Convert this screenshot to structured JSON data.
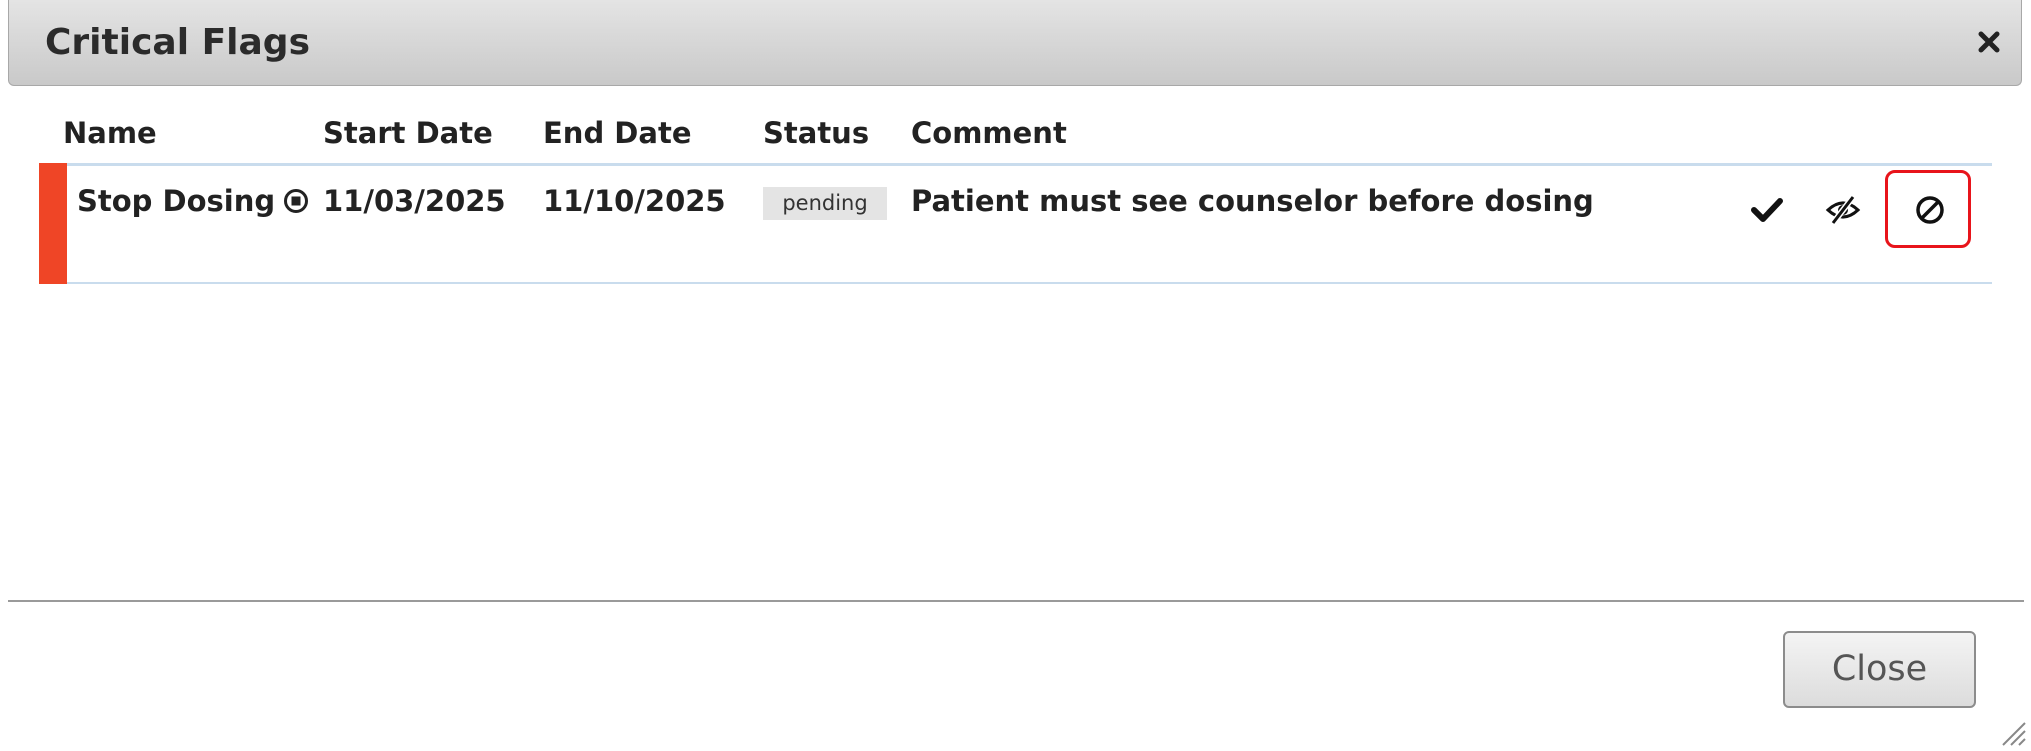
{
  "dialog": {
    "title": "Critical Flags",
    "close_icon": "close-icon"
  },
  "table": {
    "headers": {
      "name": "Name",
      "start_date": "Start Date",
      "end_date": "End Date",
      "status": "Status",
      "comment": "Comment"
    },
    "rows": [
      {
        "name": "Stop Dosing",
        "name_icon": "stop-circle-icon",
        "start_date": "11/03/2025",
        "end_date": "11/10/2025",
        "status": "pending",
        "comment": "Patient must see counselor before dosing",
        "flag_color": "#ef4526",
        "actions": [
          "check-icon",
          "eye-slash-icon",
          "ban-icon"
        ]
      }
    ]
  },
  "footer": {
    "close_label": "Close"
  },
  "colors": {
    "flag": "#ef4526",
    "highlight": "#e8141b",
    "row_border": "#c9dced"
  }
}
